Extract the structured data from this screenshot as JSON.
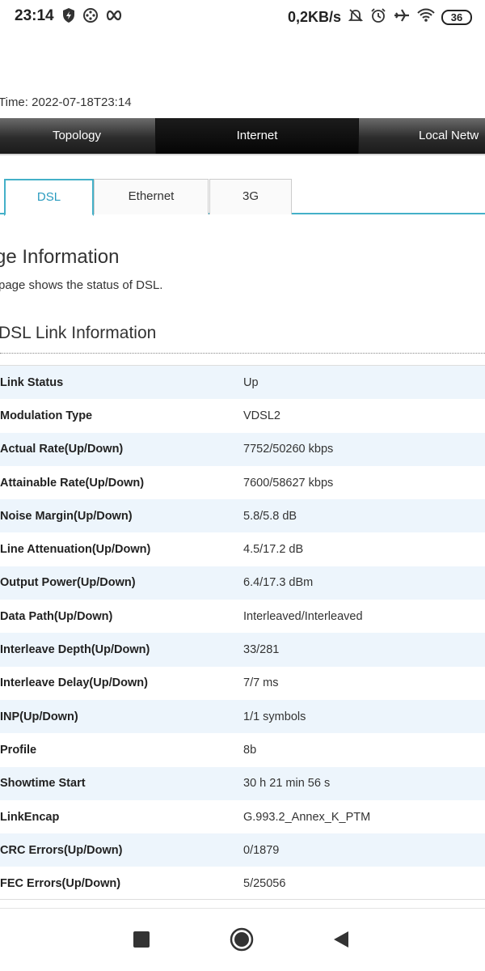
{
  "status_bar": {
    "time": "23:14",
    "speed": "0,2KB/s",
    "battery": "36",
    "icons": [
      "shield-icon",
      "aperture-icon",
      "infinity-icon",
      "bell-off-icon",
      "alarm-icon",
      "airplane-icon",
      "wifi-icon",
      "battery-icon"
    ]
  },
  "page": {
    "system_time": "Time: 2022-07-18T23:14",
    "title": "ge Information",
    "description": "page shows the status of DSL.",
    "section_title": "DSL Link Information"
  },
  "top_nav": [
    {
      "label": "Topology"
    },
    {
      "label": "Internet",
      "active": true
    },
    {
      "label": "Local Netw"
    }
  ],
  "sub_tabs": [
    {
      "label": "DSL",
      "active": true
    },
    {
      "label": "Ethernet"
    },
    {
      "label": "3G"
    }
  ],
  "dsl_info": [
    {
      "label": "Link Status",
      "value": "Up"
    },
    {
      "label": "Modulation Type",
      "value": "VDSL2"
    },
    {
      "label": "Actual Rate(Up/Down)",
      "value": "7752/50260 kbps"
    },
    {
      "label": "Attainable Rate(Up/Down)",
      "value": "7600/58627 kbps"
    },
    {
      "label": "Noise Margin(Up/Down)",
      "value": "5.8/5.8 dB"
    },
    {
      "label": "Line Attenuation(Up/Down)",
      "value": "4.5/17.2 dB"
    },
    {
      "label": "Output Power(Up/Down)",
      "value": "6.4/17.3 dBm"
    },
    {
      "label": "Data Path(Up/Down)",
      "value": "Interleaved/Interleaved"
    },
    {
      "label": "Interleave Depth(Up/Down)",
      "value": "33/281"
    },
    {
      "label": "Interleave Delay(Up/Down)",
      "value": "7/7 ms"
    },
    {
      "label": "INP(Up/Down)",
      "value": "1/1 symbols"
    },
    {
      "label": "Profile",
      "value": "8b"
    },
    {
      "label": "Showtime Start",
      "value": "30 h 21 min 56 s"
    },
    {
      "label": "LinkEncap",
      "value": "G.993.2_Annex_K_PTM"
    },
    {
      "label": "CRC Errors(Up/Down)",
      "value": "0/1879"
    },
    {
      "label": "FEC Errors(Up/Down)",
      "value": "5/25056"
    }
  ],
  "colors": {
    "accent": "#44b0c8",
    "row_alt": "#edf5fc",
    "nav_dark": "#1b1b1b"
  }
}
